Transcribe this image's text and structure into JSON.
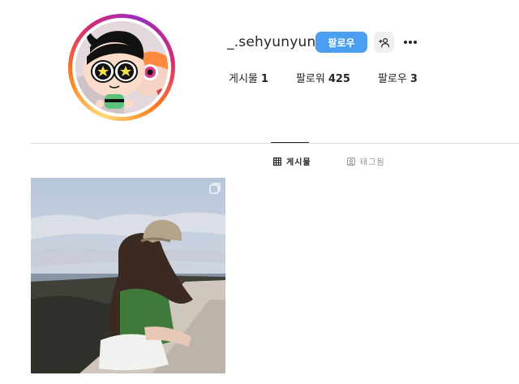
{
  "profile": {
    "username": "_.sehyunyun_",
    "follow_button": "팔로우",
    "stats": [
      {
        "label": "게시물",
        "value": "1"
      },
      {
        "label": "팔로워",
        "value": "425"
      },
      {
        "label": "팔로우",
        "value": "3"
      }
    ]
  },
  "tabs": [
    {
      "label": "게시물",
      "icon": "grid-icon",
      "active": true
    },
    {
      "label": "태그됨",
      "icon": "tagged-icon",
      "active": false
    }
  ],
  "colors": {
    "follow_button": "#4a9ff0",
    "secondary_button": "#efefef",
    "divider": "#dbdbdb",
    "text": "#262626",
    "muted_text": "#8e8e8e"
  }
}
